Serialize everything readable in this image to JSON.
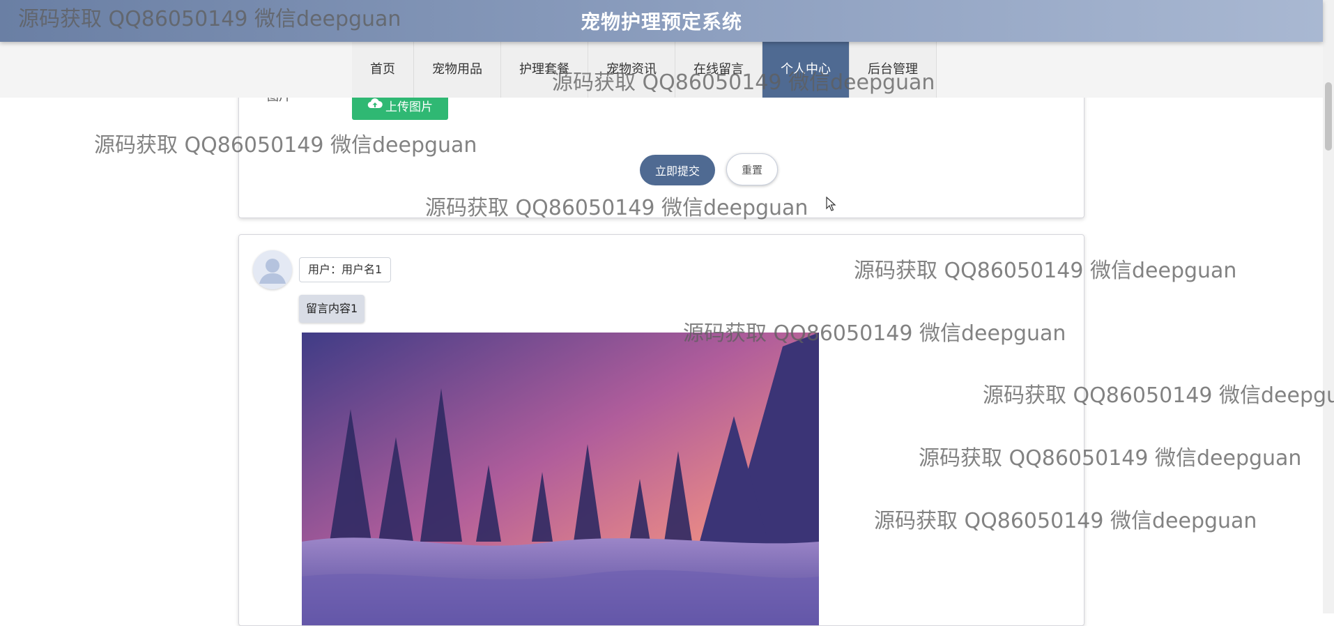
{
  "header": {
    "title": "宠物护理预定系统"
  },
  "nav": {
    "items": [
      {
        "label": "首页",
        "active": false
      },
      {
        "label": "宠物用品",
        "active": false
      },
      {
        "label": "护理套餐",
        "active": false
      },
      {
        "label": "宠物资讯",
        "active": false
      },
      {
        "label": "在线留言",
        "active": false
      },
      {
        "label": "个人中心",
        "active": true
      },
      {
        "label": "后台管理",
        "active": false
      }
    ]
  },
  "form": {
    "image_label": "图片",
    "upload_label": "上传图片",
    "submit_label": "立即提交",
    "reset_label": "重置"
  },
  "message": {
    "user": "用户：用户名1",
    "content": "留言内容1"
  },
  "watermark": "源码获取 QQ86050149 微信deepguan",
  "colors": {
    "header_start": "#6a7fa4",
    "header_end": "#a9b8d2",
    "nav_active": "#4f6a92",
    "upload_green": "#2fb873",
    "submit_blue": "#4f6a92"
  },
  "icons": [
    "cloud-upload-icon",
    "user-avatar-icon",
    "mouse-cursor-icon"
  ]
}
